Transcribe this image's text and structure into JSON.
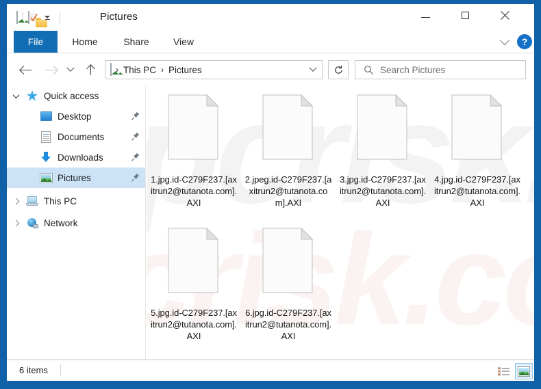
{
  "window": {
    "title": "Pictures",
    "quick_access_toolbar": [
      {
        "name": "picture-icon",
        "label": "Pictures"
      },
      {
        "name": "properties-icon",
        "label": "Properties"
      },
      {
        "name": "new-folder-icon",
        "label": "New folder"
      },
      {
        "name": "customize-caret-icon",
        "label": "Customize Quick Access Toolbar"
      }
    ],
    "controls": {
      "minimize": "Minimize",
      "maximize": "Maximize",
      "close": "Close"
    }
  },
  "ribbon": {
    "tabs": [
      {
        "label": "File",
        "selected": true
      },
      {
        "label": "Home",
        "selected": false
      },
      {
        "label": "Share",
        "selected": false
      },
      {
        "label": "View",
        "selected": false
      }
    ],
    "collapse_label": "Minimize the Ribbon",
    "help_label": "?"
  },
  "navigation": {
    "back": "Back",
    "forward": "Forward",
    "recent": "Recent locations",
    "up": "Up",
    "refresh": "Refresh",
    "breadcrumb": [
      "This PC",
      "Pictures"
    ],
    "breadcrumb_separator": "›"
  },
  "search": {
    "placeholder": "Search Pictures"
  },
  "sidebar": {
    "items": [
      {
        "label": "Quick access",
        "icon": "star-icon",
        "twisty": "down",
        "level": 0,
        "pinned": false,
        "selected": false
      },
      {
        "label": "Desktop",
        "icon": "desktop-icon",
        "twisty": "none",
        "level": 1,
        "pinned": true,
        "selected": false
      },
      {
        "label": "Documents",
        "icon": "documents-icon",
        "twisty": "none",
        "level": 1,
        "pinned": true,
        "selected": false
      },
      {
        "label": "Downloads",
        "icon": "downloads-icon",
        "twisty": "none",
        "level": 1,
        "pinned": true,
        "selected": false
      },
      {
        "label": "Pictures",
        "icon": "pictures-icon",
        "twisty": "none",
        "level": 1,
        "pinned": true,
        "selected": true
      },
      {
        "label": "This PC",
        "icon": "this-pc-icon",
        "twisty": "right",
        "level": 0,
        "pinned": false,
        "selected": false
      },
      {
        "label": "Network",
        "icon": "network-icon",
        "twisty": "right",
        "level": 0,
        "pinned": false,
        "selected": false
      }
    ]
  },
  "files": [
    {
      "name": "1.jpg.id-C279F237.[axitrun2@tutanota.com].AXI",
      "icon": "blank-file-icon"
    },
    {
      "name": "2.jpeg.id-C279F237.[axitrun2@tutanota.com].AXI",
      "icon": "blank-file-icon"
    },
    {
      "name": "3.jpg.id-C279F237.[axitrun2@tutanota.com].AXI",
      "icon": "blank-file-icon"
    },
    {
      "name": "4.jpg.id-C279F237.[axitrun2@tutanota.com].AXI",
      "icon": "blank-file-icon"
    },
    {
      "name": "5.jpg.id-C279F237.[axitrun2@tutanota.com].AXI",
      "icon": "blank-file-icon"
    },
    {
      "name": "6.jpg.id-C279F237.[axitrun2@tutanota.com].AXI",
      "icon": "blank-file-icon"
    }
  ],
  "watermark": {
    "top_text": "pcrisk.com",
    "bottom_text": "pcrisk.com"
  },
  "status": {
    "item_count": "6 items",
    "view_details_label": "Details view",
    "view_largeicons_label": "Large icons view"
  },
  "colors": {
    "window_frame": "#1061A8",
    "file_tab": "#116EB4",
    "selection": "#cce3f7",
    "help_button": "#1471C6"
  }
}
